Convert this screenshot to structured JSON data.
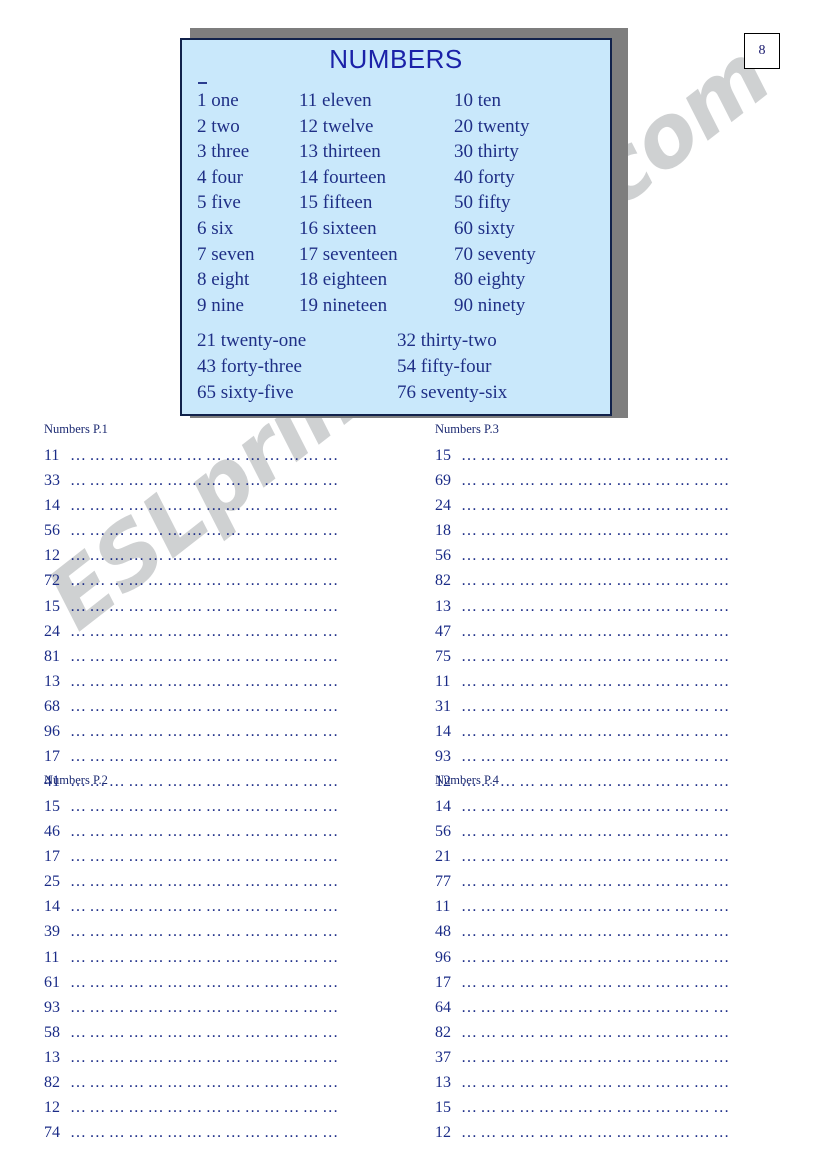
{
  "page": {
    "number": "8"
  },
  "watermark": {
    "text": "ESLprintables.com"
  },
  "poster": {
    "title": "NUMBERS",
    "rows": [
      {
        "col1": "1 one",
        "col2": "11 eleven",
        "col3": "10 ten"
      },
      {
        "col1": "2 two",
        "col2": "12 twelve",
        "col3": "20 twenty"
      },
      {
        "col1": "3 three",
        "col2": "13 thirteen",
        "col3": "30 thirty"
      },
      {
        "col1": "4 four",
        "col2": "14 fourteen",
        "col3": "40 forty"
      },
      {
        "col1": "5 five",
        "col2": "15 fifteen",
        "col3": "50 fifty"
      },
      {
        "col1": "6 six",
        "col2": "16 sixteen",
        "col3": "60 sixty"
      },
      {
        "col1": "7 seven",
        "col2": "17 seventeen",
        "col3": "70 seventy"
      },
      {
        "col1": "8 eight",
        "col2": "18 eighteen",
        "col3": "80 eighty"
      },
      {
        "col1": "9 nine",
        "col2": "19 nineteen",
        "col3": "90 ninety"
      }
    ],
    "compound_rows": [
      {
        "left": "21 twenty-one",
        "right": "32 thirty-two"
      },
      {
        "left": "43 forty-three",
        "right": "54 fifty-four"
      },
      {
        "left": "65 sixty-five",
        "right": "76 seventy-six"
      }
    ]
  },
  "exercises": [
    {
      "title": "Numbers P.1",
      "items": [
        "11",
        "33",
        "14",
        "56",
        "12",
        "72",
        "15",
        "24",
        "81",
        "13",
        "68",
        "96",
        "17",
        "41"
      ],
      "dots": "……………………………………"
    },
    {
      "title": "Numbers P.2",
      "items": [
        "15",
        "46",
        "17",
        "25",
        "14",
        "39",
        "11",
        "61",
        "93",
        "58",
        "13",
        "82",
        "12",
        "74"
      ],
      "dots": "……………………………………"
    },
    {
      "title": "Numbers P.3",
      "items": [
        "15",
        "69",
        "24",
        "18",
        "56",
        "82",
        "13",
        "47",
        "75",
        "11",
        "31",
        "14",
        "93",
        "12"
      ],
      "dots": "……………………………………"
    },
    {
      "title": "Numbers P.4",
      "items": [
        "14",
        "56",
        "21",
        "77",
        "11",
        "48",
        "96",
        "17",
        "64",
        "82",
        "37",
        "13",
        "15",
        "12"
      ],
      "dots": "……………………………………"
    }
  ],
  "colors": {
    "poster_background": "#c9e8fb",
    "poster_border": "#11224b",
    "poster_shadow": "#7e7e7e",
    "title_blue": "#1b21a8",
    "text_blue": "#1f2f86",
    "watermark_gray": "#969b9e"
  }
}
